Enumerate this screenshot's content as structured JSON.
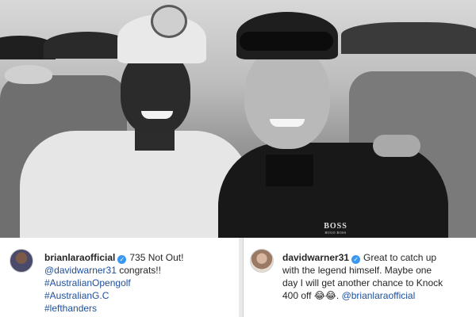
{
  "photo": {
    "description_icon": "group-photo",
    "shirt_brand": "BOSS",
    "shirt_brand_sub": "HUGO BOSS"
  },
  "left_post": {
    "username": "brianlaraofficial",
    "verified_icon": "verified-badge-icon",
    "caption_first": "735 Not Out!",
    "mention": "@davidwarner31",
    "caption_after_mention": "congrats!!",
    "hashtags": [
      "#AustralianOpengolf",
      "#AustralianG.C",
      "#lefthanders"
    ]
  },
  "right_post": {
    "username": "davidwarner31",
    "verified_icon": "verified-badge-icon",
    "caption_first": "Great to catch up",
    "caption_line2": "with the legend himself. Maybe one",
    "caption_line3": "day I will get another chance to Knock",
    "caption_line4_text": "400 off",
    "emoji": "😂😂.",
    "mention": "@brianlaraofficial"
  },
  "colors": {
    "link": "#1e4f9c",
    "verified": "#3897f0",
    "text": "#262626"
  }
}
